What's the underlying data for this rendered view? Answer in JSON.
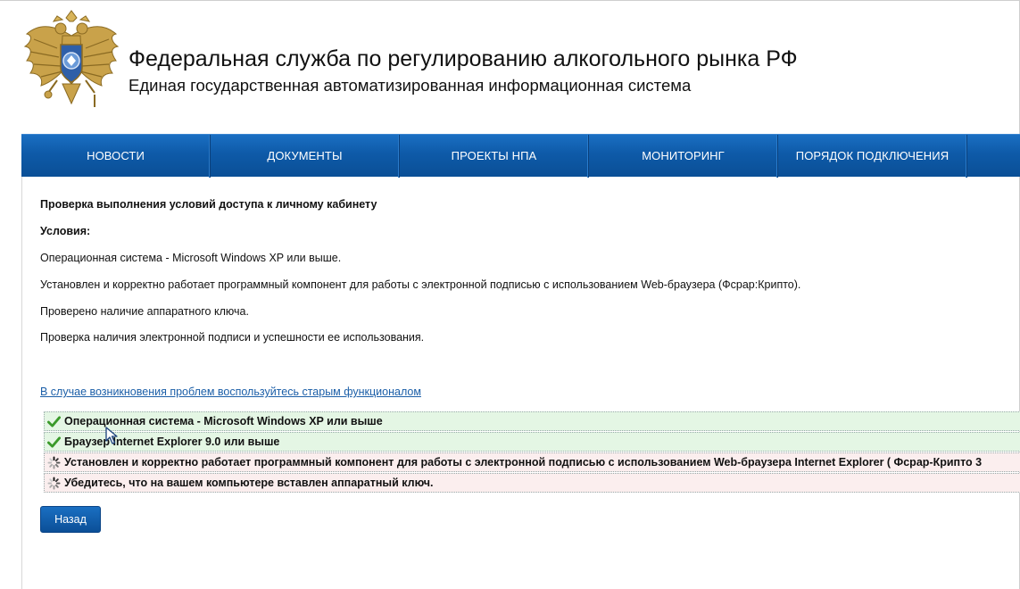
{
  "header": {
    "title": "Федеральная служба по регулированию алкогольного рынка РФ",
    "subtitle": "Единая государственная автоматизированная информационная система",
    "emblem_icon": "double-headed-eagle-emblem"
  },
  "nav": {
    "items": [
      {
        "label": "НОВОСТИ"
      },
      {
        "label": "ДОКУМЕНТЫ"
      },
      {
        "label": "ПРОЕКТЫ НПА"
      },
      {
        "label": "МОНИТОРИНГ"
      },
      {
        "label": "ПОРЯДОК ПОДКЛЮЧЕНИЯ"
      }
    ]
  },
  "main": {
    "heading": "Проверка выполнения условий доступа к личному кабинету",
    "conditions_label": "Условия:",
    "conditions": [
      "Операционная система - Microsoft Windows XP или выше.",
      "Установлен и корректно работает программный компонент для работы с электронной подписью с использованием Web-браузера (Фсрар:Крипто).",
      "Проверено наличие аппаратного ключа.",
      "Проверка наличия электронной подписи и успешности ее использования."
    ],
    "old_link": "В случае возникновения проблем воспользуйтесь старым функционалом",
    "checks": [
      {
        "status": "ok",
        "icon": "checkmark-icon",
        "text": "Операционная система - Microsoft Windows XP или выше"
      },
      {
        "status": "ok",
        "icon": "checkmark-icon",
        "text": "Браузер Internet Explorer 9.0 или выше"
      },
      {
        "status": "pending",
        "icon": "loading-spinner-icon",
        "text": "Установлен и корректно работает программный компонент для работы с электронной подписью с использованием Web-браузера Internet Explorer ( Фсрар-Крипто 3"
      },
      {
        "status": "pending",
        "icon": "loading-spinner-icon",
        "text": "Убедитесь, что на вашем компьютере вставлен аппаратный ключ."
      }
    ],
    "back_button": "Назад"
  },
  "colors": {
    "nav_blue": "#0e5aa8",
    "link_blue": "#1c5fa8",
    "ok_bg": "#e4f6e4",
    "pending_bg": "#fbeeee",
    "check_green": "#3a9a2a"
  }
}
